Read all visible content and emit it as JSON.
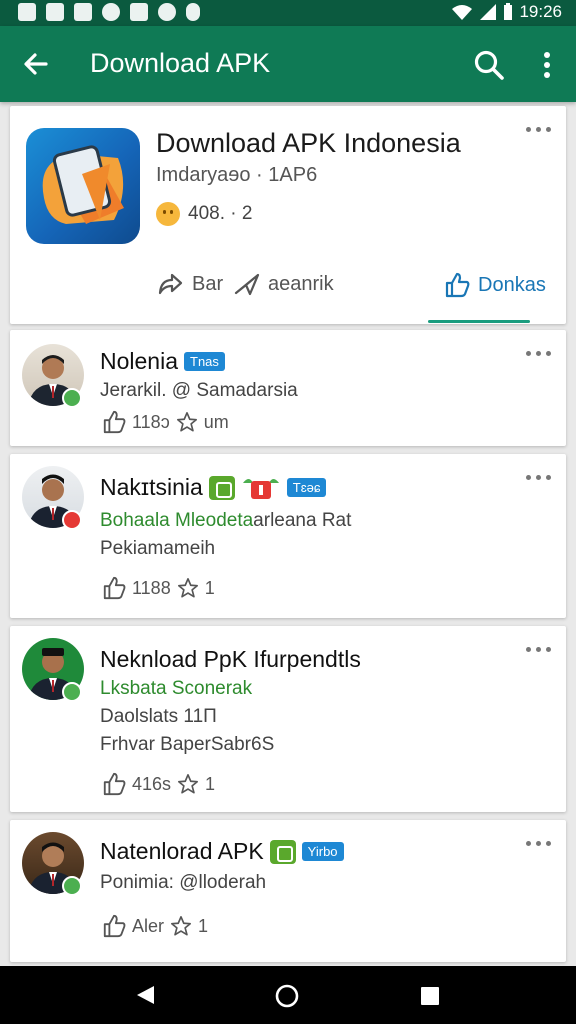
{
  "status_bar": {
    "time": "19:26"
  },
  "app_bar": {
    "title": "Download APK"
  },
  "app_card": {
    "name": "Download APK Indonesia",
    "subtitle": "Imdaryaɘo · 1AP6",
    "rating": "408. · 2",
    "actions": [
      {
        "label": "Bar",
        "icon": "share-icon"
      },
      {
        "label": "aeanrik",
        "icon": "send-icon"
      },
      {
        "label": "Donkas",
        "icon": "like-icon"
      }
    ]
  },
  "posts": [
    {
      "name": "Nolenia",
      "tag": "Tnas",
      "line1": "Jerarkil. @ Samadarsia",
      "likes": "118ɔ",
      "rating": "um"
    },
    {
      "name": "Nakɪtsinia",
      "tag": "Tɛəɕ",
      "line1_green": "Bohaala Mleodeta",
      "line1_rest": "arleana Rat",
      "line2": "Pekiamameih",
      "likes": "1188",
      "rating": "1"
    },
    {
      "name": "Neknload PpK Ifurpendtls",
      "line1_green": "Lksbata Sconerak",
      "line2": "Daolslats 11П",
      "line3": "Frhvar BaperSabr6S",
      "likes": "416s",
      "rating": "1"
    },
    {
      "name": "Natenlorad APK",
      "tag": "Yirbo",
      "line1": "Ponimia: @lloderah",
      "likes": "Aler",
      "rating": "1"
    }
  ],
  "colors": {
    "status_bar": "#0b5a3f",
    "app_bar": "#0f7a55",
    "tag_blue": "#1e88d4",
    "verified_green": "#4caf50",
    "accent_blue": "#1976b5"
  }
}
